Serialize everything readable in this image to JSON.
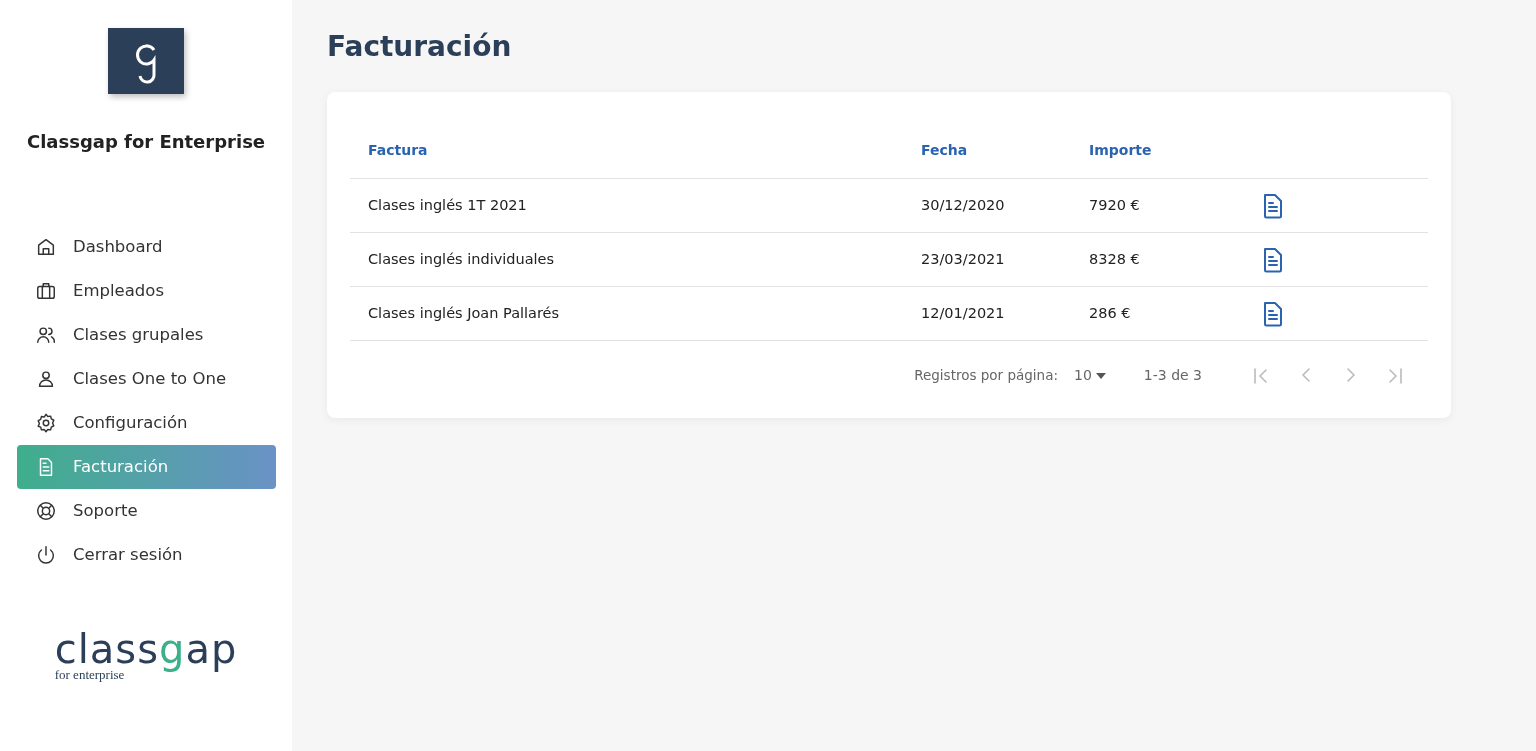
{
  "sidebar": {
    "app_title": "Classgap for Enterprise",
    "items": [
      {
        "label": "Dashboard",
        "selected": false
      },
      {
        "label": "Empleados",
        "selected": false
      },
      {
        "label": "Clases grupales",
        "selected": false
      },
      {
        "label": "Clases One to One",
        "selected": false
      },
      {
        "label": "Configuración",
        "selected": false
      },
      {
        "label": "Facturación",
        "selected": true
      },
      {
        "label": "Soporte",
        "selected": false
      },
      {
        "label": "Cerrar sesión",
        "selected": false
      }
    ],
    "footer_logo": {
      "wordmark_start": "class",
      "wordmark_g": "g",
      "wordmark_end": "ap",
      "tagline": "for enterprise"
    }
  },
  "page_title": "Facturación",
  "table": {
    "columns": [
      "Factura",
      "Fecha",
      "Importe"
    ],
    "rows": [
      {
        "factura": "Clases inglés 1T 2021",
        "fecha": "30/12/2020",
        "importe": "7920 €"
      },
      {
        "factura": "Clases inglés individuales",
        "fecha": "23/03/2021",
        "importe": "8328 €"
      },
      {
        "factura": "Clases inglés Joan Pallarés",
        "fecha": "12/01/2021",
        "importe": "286 €"
      }
    ]
  },
  "pagination": {
    "rows_label": "Registros por página:",
    "rows_value": "10",
    "range": "1-3 de 3",
    "buttons": [
      {
        "kind": "first",
        "disabled": true
      },
      {
        "kind": "prev",
        "disabled": true
      },
      {
        "kind": "next",
        "disabled": true
      },
      {
        "kind": "last",
        "disabled": true
      }
    ]
  }
}
